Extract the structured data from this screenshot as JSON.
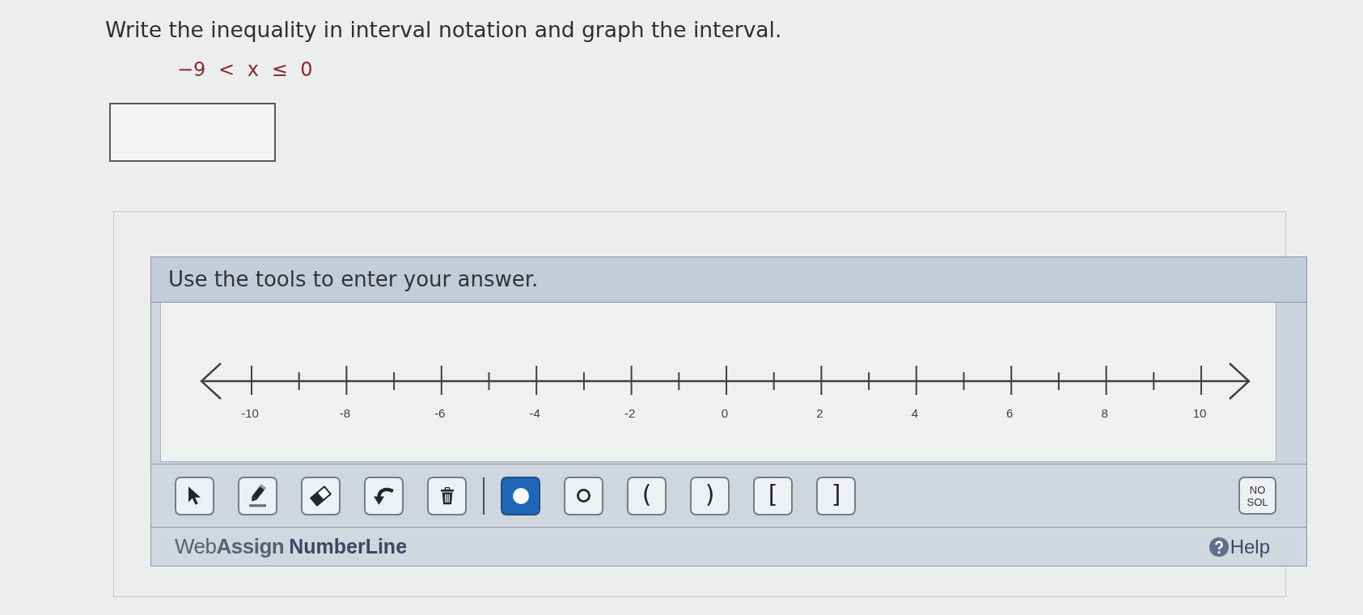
{
  "prompt": "Write the inequality in interval notation and graph the interval.",
  "inequality": "−9 < x ≤ 0",
  "tool_panel": {
    "title": "Use the tools to enter your answer.",
    "number_line": {
      "labels": [
        "-10",
        "-8",
        "-6",
        "-4",
        "-2",
        "0",
        "2",
        "4",
        "6",
        "8",
        "10"
      ]
    },
    "edit_tools": [
      {
        "kind": "pointer",
        "selected": false
      },
      {
        "kind": "pencil",
        "selected": false
      },
      {
        "kind": "eraser",
        "selected": false
      },
      {
        "kind": "undo",
        "selected": false
      },
      {
        "kind": "delete",
        "selected": false
      }
    ],
    "point_tools": [
      {
        "kind": "closed_point",
        "selected": true
      },
      {
        "kind": "open_point",
        "selected": false
      },
      {
        "kind": "endpoint",
        "label": "(",
        "selected": false
      },
      {
        "kind": "endpoint",
        "label": ")",
        "selected": false
      },
      {
        "kind": "endpoint",
        "label": "[",
        "selected": false
      },
      {
        "kind": "endpoint",
        "label": "]",
        "selected": false
      }
    ],
    "no_solution_button": "NO SOL",
    "footer": {
      "logo": "Web**Assign**",
      "product": "NumberLine",
      "help": "Help"
    }
  }
}
